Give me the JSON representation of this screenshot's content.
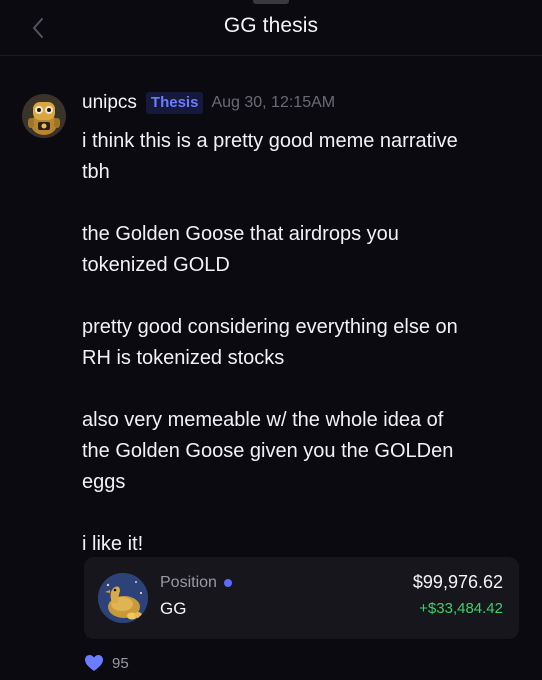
{
  "header": {
    "title": "GG thesis",
    "back_icon": "chevron-left-icon"
  },
  "post": {
    "username": "unipcs",
    "tag": "Thesis",
    "timestamp": "Aug 30, 12:15AM",
    "paragraphs": [
      "i think this is a pretty good meme narrative\ntbh",
      "the Golden Goose that airdrops you\ntokenized GOLD",
      "pretty good considering everything else on\nRH is tokenized stocks",
      "also very memeable w/ the whole idea of\nthe Golden Goose given you the GOLDen\neggs",
      "i like it!"
    ],
    "position": {
      "label": "Position",
      "ticker": "GG",
      "value": "$99,976.62",
      "change": "+$33,484.42"
    },
    "likes": "95"
  },
  "colors": {
    "background": "#0b0a11",
    "accent": "#6b7cff",
    "positive": "#3ecf6a",
    "like": "#6b7cff"
  }
}
